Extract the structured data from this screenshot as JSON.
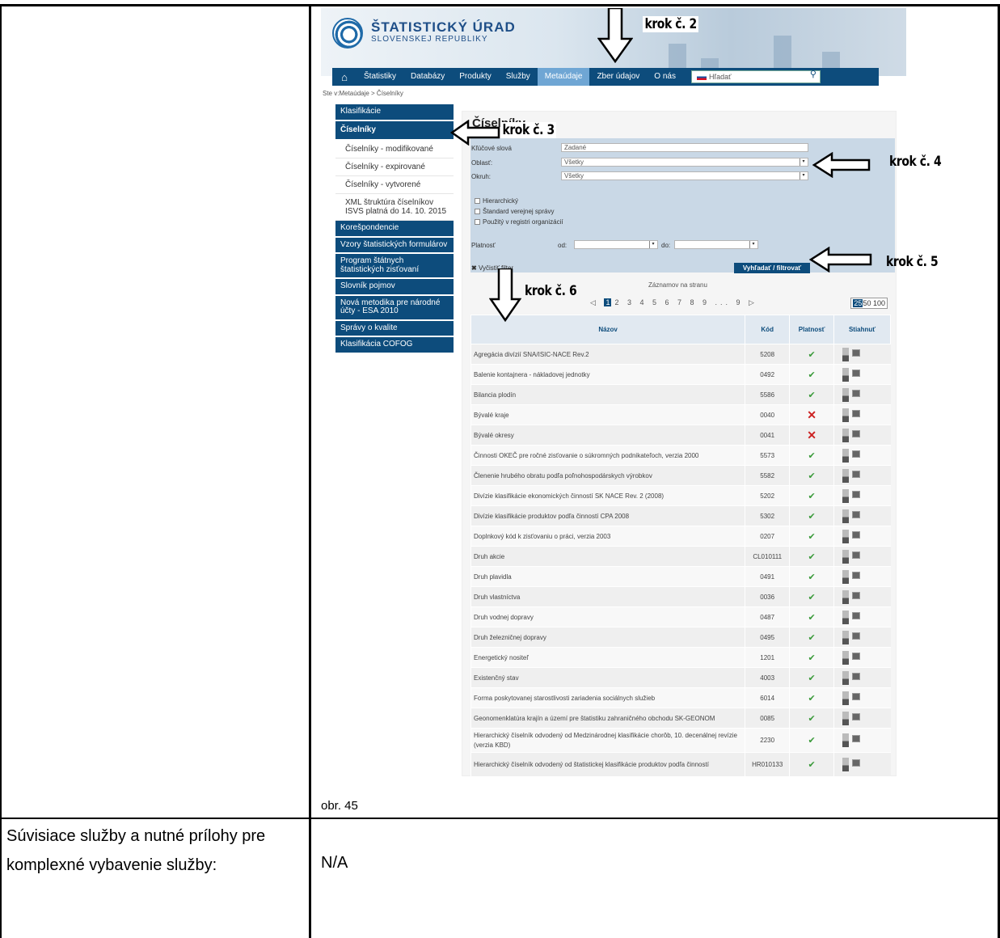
{
  "screenshot": {
    "logo": {
      "title": "ŠTATISTICKÝ ÚRAD",
      "subtitle": "SLOVENSKEJ REPUBLIKY"
    },
    "nav": {
      "items": [
        "Štatistiky",
        "Databázy",
        "Produkty",
        "Služby",
        "Metaúdaje",
        "Zber údajov",
        "O nás"
      ],
      "active": "Metaúdaje",
      "search_placeholder": "Hľadať"
    },
    "breadcrumb": "Ste v:Metaúdaje > Číselníky",
    "sidebar": {
      "items": [
        {
          "label": "Klasifikácie"
        },
        {
          "label": "Číselníky",
          "active": true
        },
        {
          "label": "Číselníky - modifikované",
          "sub": true
        },
        {
          "label": "Číselníky - expirované",
          "sub": true
        },
        {
          "label": "Číselníky - vytvorené",
          "sub": true
        },
        {
          "label": "XML štruktúra číselníkov ISVS platná do 14. 10. 2015",
          "sub": true
        },
        {
          "label": "Korešpondencie"
        },
        {
          "label": "Vzory štatistických formulárov"
        },
        {
          "label": "Program štátnych štatistických zisťovaní"
        },
        {
          "label": "Slovník pojmov"
        },
        {
          "label": "Nová metodika pre národné účty - ESA 2010"
        },
        {
          "label": "Správy o kvalite"
        },
        {
          "label": "Klasifikácia COFOG"
        }
      ]
    },
    "main": {
      "title": "Číselníky",
      "filter": {
        "keyword_label": "Kľúčové slová",
        "keyword_value": "Zadané",
        "area_label": "Oblasť:",
        "area_value": "Všetky",
        "circle_label": "Okruh:",
        "circle_value": "Všetky",
        "checkboxes": [
          "Hierarchický",
          "Štandard verejnej správy",
          "Použitý v registri organizácií"
        ],
        "validity_label": "Platnosť",
        "from_label": "od:",
        "to_label": "do:",
        "clear_label": "Vyčistiť filter",
        "search_button": "Vyhľadať / filtrovať"
      },
      "pager": {
        "per_page_label": "Záznamov na stranu",
        "current_page": "1",
        "pages": "2 3 4 5 6 7 8 9 ... 9",
        "per_page_options": [
          "25",
          "50",
          "100"
        ],
        "per_page_selected": "25"
      },
      "table": {
        "headers": {
          "name": "Názov",
          "code": "Kód",
          "validity": "Platnosť",
          "download": "Stiahnuť"
        },
        "rows": [
          {
            "name": "Agregácia divízií SNA/ISIC-NACE Rev.2",
            "code": "5208",
            "valid": true
          },
          {
            "name": "Balenie kontajnera - nákladovej jednotky",
            "code": "0492",
            "valid": true
          },
          {
            "name": "Bilancia plodín",
            "code": "5586",
            "valid": true
          },
          {
            "name": "Bývalé kraje",
            "code": "0040",
            "valid": false
          },
          {
            "name": "Bývalé okresy",
            "code": "0041",
            "valid": false
          },
          {
            "name": "Činnosti OKEČ pre ročné zisťovanie o súkromných podnikateľoch, verzia 2000",
            "code": "5573",
            "valid": true
          },
          {
            "name": "Členenie hrubého obratu podľa poľnohospodárskych výrobkov",
            "code": "5582",
            "valid": true
          },
          {
            "name": "Divízie klasifikácie ekonomických činností SK NACE Rev. 2 (2008)",
            "code": "5202",
            "valid": true
          },
          {
            "name": "Divízie klasifikácie produktov podľa činností CPA 2008",
            "code": "5302",
            "valid": true
          },
          {
            "name": "Doplnkový kód k zisťovaniu o práci, verzia 2003",
            "code": "0207",
            "valid": true
          },
          {
            "name": "Druh akcie",
            "code": "CL010111",
            "valid": true
          },
          {
            "name": "Druh plavidla",
            "code": "0491",
            "valid": true
          },
          {
            "name": "Druh vlastníctva",
            "code": "0036",
            "valid": true
          },
          {
            "name": "Druh vodnej dopravy",
            "code": "0487",
            "valid": true
          },
          {
            "name": "Druh železničnej dopravy",
            "code": "0495",
            "valid": true
          },
          {
            "name": "Energetický nositeľ",
            "code": "1201",
            "valid": true
          },
          {
            "name": "Existenčný stav",
            "code": "4003",
            "valid": true
          },
          {
            "name": "Forma poskytovanej starostlivosti zariadenia sociálnych služieb",
            "code": "6014",
            "valid": true
          },
          {
            "name": "Geonomenklatúra krajín a území pre štatistiku zahraničného obchodu SK-GEONOM",
            "code": "0085",
            "valid": true
          },
          {
            "name": "Hierarchický číselník odvodený od Medzinárodnej klasifikácie chorôb, 10. decenálnej revízie (verzia KBD)",
            "code": "2230",
            "valid": true
          },
          {
            "name": "Hierarchický číselník odvodený od štatistickej klasifikácie produktov podľa činností",
            "code": "HR010133",
            "valid": true
          }
        ]
      }
    },
    "annotations": [
      "krok č. 2",
      "krok č. 3",
      "krok č. 4",
      "krok č. 5",
      "krok č. 6"
    ]
  },
  "document": {
    "caption": "obr. 45",
    "row_label": "Súvisiace služby a nutné prílohy pre komplexné vybavenie služby:",
    "row_value": "N/A"
  }
}
